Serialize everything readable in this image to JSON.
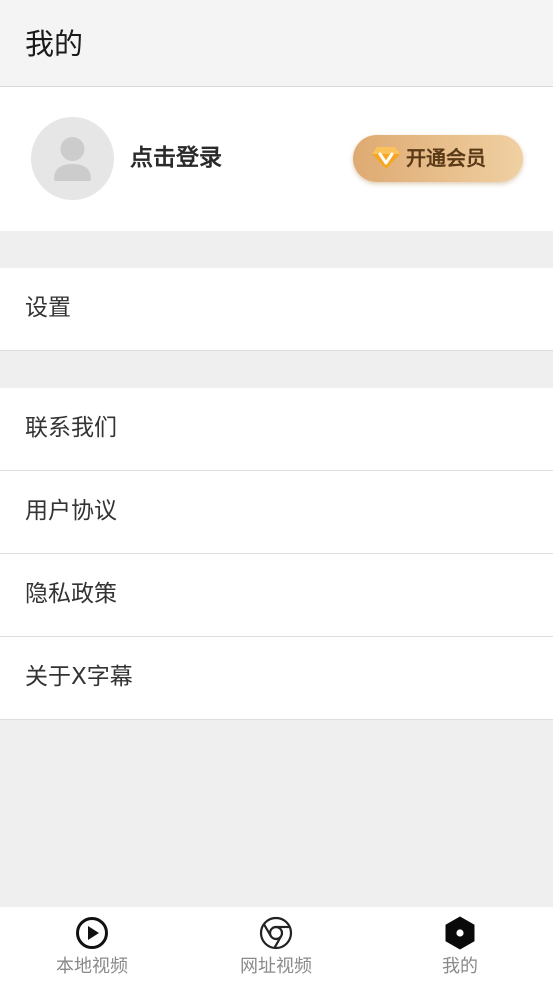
{
  "header": {
    "title": "我的"
  },
  "profile": {
    "avatar_icon": "user-avatar-icon",
    "login_label": "点击登录",
    "vip_button_label": "开通会员",
    "vip_icon": "diamond-v-icon"
  },
  "menu_groups": [
    {
      "items": [
        {
          "label": "设置"
        }
      ]
    },
    {
      "items": [
        {
          "label": "联系我们"
        },
        {
          "label": "用户协议"
        },
        {
          "label": "隐私政策"
        },
        {
          "label": "关于X字幕"
        }
      ]
    }
  ],
  "tabbar": {
    "tabs": [
      {
        "label": "本地视频",
        "icon": "play-circle-icon"
      },
      {
        "label": "网址视频",
        "icon": "browser-icon"
      },
      {
        "label": "我的",
        "icon": "hexagon-icon",
        "active": true
      }
    ]
  },
  "colors": {
    "page_background": "#efefef",
    "vip_gradient_start": "#deaa72",
    "vip_gradient_end": "#f0d0a2",
    "vip_text": "#5a3a16"
  }
}
